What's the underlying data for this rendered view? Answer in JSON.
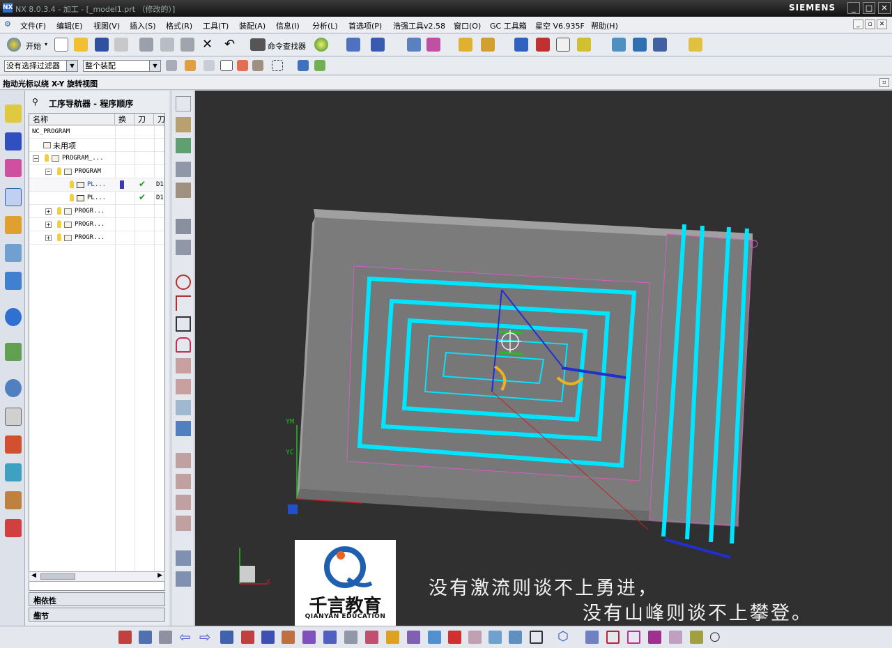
{
  "app": {
    "title": "NX 8.0.3.4 - 加工 - [_model1.prt （修改的）]",
    "brand": "SIEMENS",
    "logo": "NX"
  },
  "menu": {
    "items": [
      "文件(F)",
      "编辑(E)",
      "视图(V)",
      "插入(S)",
      "格式(R)",
      "工具(T)",
      "装配(A)",
      "信息(I)",
      "分析(L)",
      "首选项(P)",
      "浩强工具v2.58",
      "窗口(O)",
      "GC 工具箱",
      "星空 V6.935F",
      "帮助(H)"
    ]
  },
  "toolbar": {
    "start_label": "开始",
    "command_finder_label": "命令查找器"
  },
  "selection": {
    "filter": "没有选择过滤器",
    "scope": "整个装配"
  },
  "status": {
    "message": "拖动光标以绕 X-Y 旋转视图"
  },
  "navigator": {
    "title": "工序导航器 - 程序顺序",
    "columns": [
      "名称",
      "换",
      "刀",
      "刀"
    ],
    "rows": [
      {
        "label": "NC_PROGRAM"
      },
      {
        "label": "未用项"
      },
      {
        "label": "PROGRAM_..."
      },
      {
        "label": "PROGRAM"
      },
      {
        "label": "PL...",
        "tool": "D1"
      },
      {
        "label": "PL...",
        "tool": "D1"
      },
      {
        "label": "PROGR..."
      },
      {
        "label": "PROGR..."
      },
      {
        "label": "PROGR..."
      }
    ],
    "dependencies_label": "相依性",
    "details_label": "细节"
  },
  "viewport": {
    "axis_labels": {
      "ym": "YM",
      "yc": "YC",
      "x": "X"
    }
  },
  "overlay": {
    "logo_cn": "千言教育",
    "logo_en": "QIANYAN EDUCATION",
    "subtitle_line1": "没有激流则谈不上勇进，",
    "subtitle_line2": "没有山峰则谈不上攀登。"
  },
  "colors": {
    "toolpath": "#00e5ff",
    "viewport_bg": "#303030",
    "part": "#7d7d7d"
  }
}
